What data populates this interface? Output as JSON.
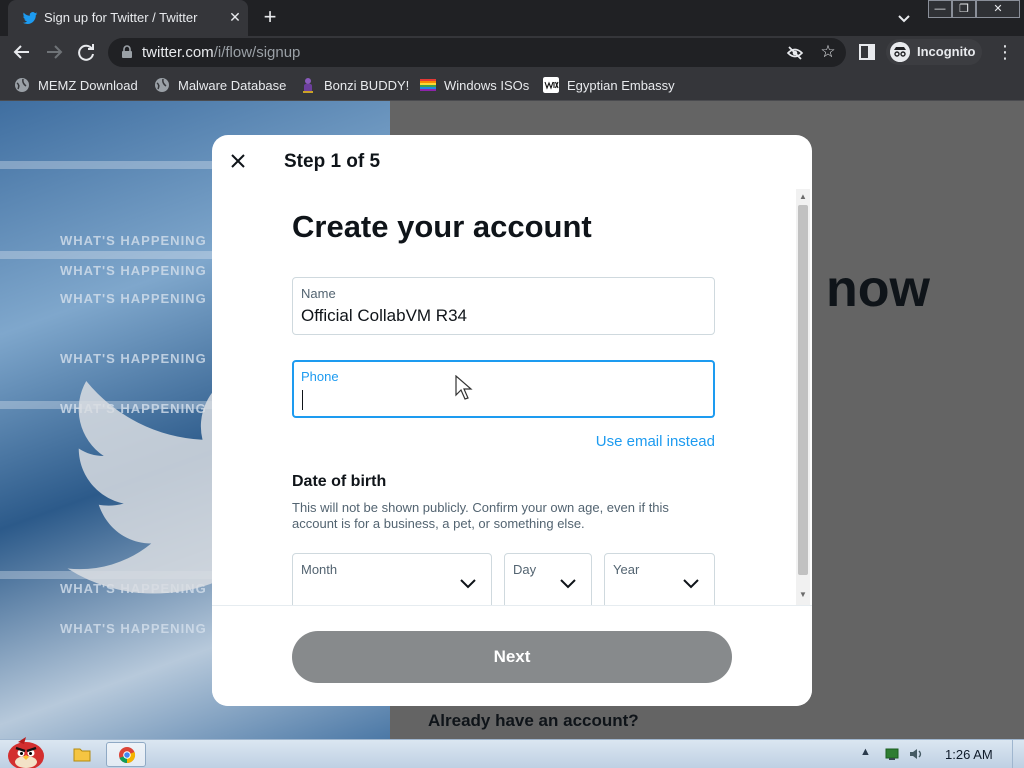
{
  "browser": {
    "tab_title": "Sign up for Twitter / Twitter",
    "tab_close": "✕",
    "new_tab": "+",
    "url_host": "twitter.com",
    "url_path": "/i/flow/signup",
    "star": "☆",
    "incognito_label": "Incognito",
    "menu": "⋮",
    "window_min": "—",
    "window_max": "❐",
    "window_close": "✕"
  },
  "bookmarks": [
    {
      "label": "MEMZ Download",
      "icon": "globe-icon",
      "color": "#9aa0a6"
    },
    {
      "label": "Malware Database",
      "icon": "globe-icon",
      "color": "#9aa0a6"
    },
    {
      "label": "Bonzi BUDDY!",
      "icon": "bonzi-icon",
      "color": "#7b4fa8"
    },
    {
      "label": "Windows ISOs",
      "icon": "rainbow-flag-icon",
      "color": "#e53935"
    },
    {
      "label": "Egyptian Embassy",
      "icon": "wix-icon",
      "color": "#ffffff"
    }
  ],
  "page": {
    "hero_text": "WHAT'S HAPPENING",
    "right_word": "now",
    "already": "Already have an account?"
  },
  "modal": {
    "step": "Step 1 of 5",
    "heading": "Create your account",
    "name_label": "Name",
    "name_value": "Official CollabVM R34",
    "phone_label": "Phone",
    "phone_value": "",
    "use_email": "Use email instead",
    "dob_title": "Date of birth",
    "dob_desc": "This will not be shown publicly. Confirm your own age, even if this account is for a business, a pet, or something else.",
    "month_label": "Month",
    "day_label": "Day",
    "year_label": "Year",
    "next_label": "Next"
  },
  "taskbar": {
    "clock": "1:26 AM"
  },
  "colors": {
    "twitter_blue": "#1d9bf0",
    "next_disabled": "#878a8c",
    "chrome_dark": "#202124"
  }
}
